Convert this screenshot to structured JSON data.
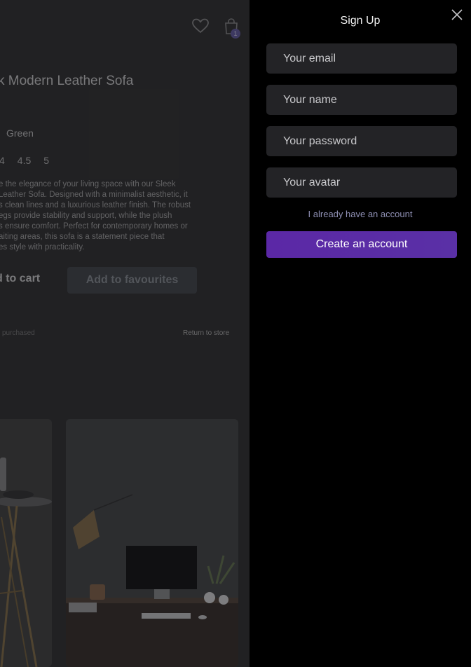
{
  "product": {
    "title": "k Modern Leather Sofa",
    "color": "Green",
    "sizes": [
      "4",
      "4.5",
      "5"
    ],
    "description": [
      "e the elegance of your living space with our Sleek",
      " Leather Sofa. Designed with a minimalist aesthetic, it",
      "s clean lines and a luxurious leather finish. The robust",
      "egs provide stability and support, while the plush",
      "s ensure comfort. Perfect for contemporary homes or",
      "aiting areas, this sofa is a statement piece that",
      "es style with practicality."
    ],
    "add_to_cart": "d to cart",
    "add_to_favourites": "Add to favourites",
    "purchased": "purchased",
    "return_to_store": "Return to store"
  },
  "header": {
    "cart_count": "1",
    "heart_icon": "heart-icon",
    "bag_icon": "shopping-bag-icon"
  },
  "signup": {
    "title": "Sign Up",
    "close_icon": "close-icon",
    "email_placeholder": "Your email",
    "name_placeholder": "Your name",
    "password_placeholder": "Your password",
    "avatar_placeholder": "Your avatar",
    "have_account_link": "I already have an account",
    "submit_label": "Create an account"
  },
  "colors": {
    "accent": "#5b28a6",
    "link": "#8f90b4",
    "field_bg": "#232326",
    "drawer_bg": "#000000"
  }
}
